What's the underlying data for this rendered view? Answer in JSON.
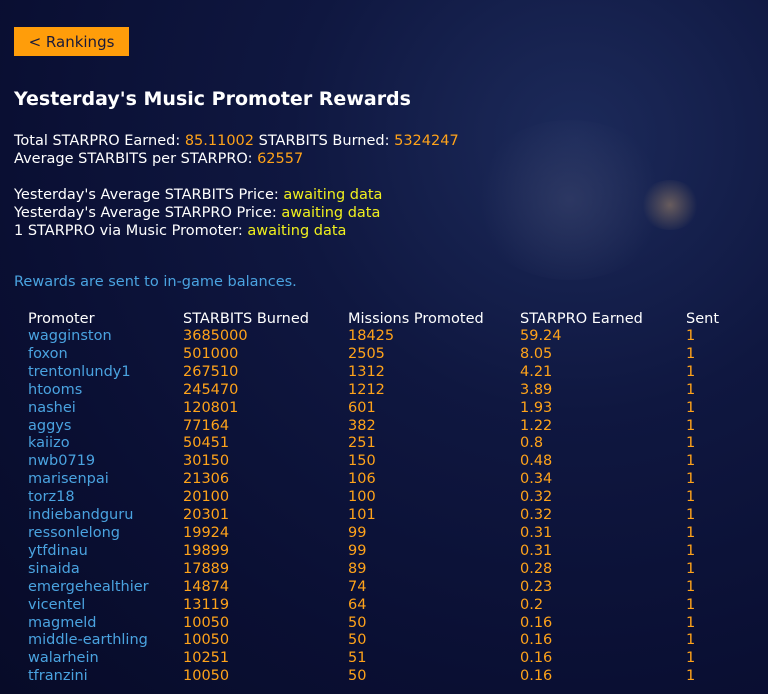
{
  "nav": {
    "back_label": "< Rankings"
  },
  "page": {
    "title": "Yesterday's Music Promoter Rewards"
  },
  "stats": {
    "total_earned_label": "Total STARPRO Earned:",
    "total_earned_value": "85.11002",
    "burned_label": "STARBITS Burned:",
    "burned_value": "5324247",
    "avg_label": "Average STARBITS per STARPRO:",
    "avg_value": "62557",
    "starbits_price_label": "Yesterday's Average STARBITS Price:",
    "starbits_price_value": "awaiting data",
    "starpro_price_label": "Yesterday's Average STARPRO Price:",
    "starpro_price_value": "awaiting data",
    "via_label": "1 STARPRO via Music Promoter:",
    "via_value": "awaiting data"
  },
  "notice": "Rewards are sent to in-game balances.",
  "table": {
    "headers": [
      "Promoter",
      "STARBITS Burned",
      "Missions Promoted",
      "STARPRO Earned",
      "Sent"
    ],
    "rows": [
      [
        "wagginston",
        "3685000",
        "18425",
        "59.24",
        "1"
      ],
      [
        "foxon",
        "501000",
        "2505",
        "8.05",
        "1"
      ],
      [
        "trentonlundy1",
        "267510",
        "1312",
        "4.21",
        "1"
      ],
      [
        "htooms",
        "245470",
        "1212",
        "3.89",
        "1"
      ],
      [
        "nashei",
        "120801",
        "601",
        "1.93",
        "1"
      ],
      [
        "aggys",
        "77164",
        "382",
        "1.22",
        "1"
      ],
      [
        "kaiizo",
        "50451",
        "251",
        "0.8",
        "1"
      ],
      [
        "nwb0719",
        "30150",
        "150",
        "0.48",
        "1"
      ],
      [
        "marisenpai",
        "21306",
        "106",
        "0.34",
        "1"
      ],
      [
        "torz18",
        "20100",
        "100",
        "0.32",
        "1"
      ],
      [
        "indiebandguru",
        "20301",
        "101",
        "0.32",
        "1"
      ],
      [
        "ressonlelong",
        "19924",
        "99",
        "0.31",
        "1"
      ],
      [
        "ytfdinau",
        "19899",
        "99",
        "0.31",
        "1"
      ],
      [
        "sinaida",
        "17889",
        "89",
        "0.28",
        "1"
      ],
      [
        "emergehealthier",
        "14874",
        "74",
        "0.23",
        "1"
      ],
      [
        "vicentel",
        "13119",
        "64",
        "0.2",
        "1"
      ],
      [
        "magmeld",
        "10050",
        "50",
        "0.16",
        "1"
      ],
      [
        "middle-earthling",
        "10050",
        "50",
        "0.16",
        "1"
      ],
      [
        "walarhein",
        "10251",
        "51",
        "0.16",
        "1"
      ],
      [
        "tfranzini",
        "10050",
        "50",
        "0.16",
        "1"
      ]
    ]
  }
}
